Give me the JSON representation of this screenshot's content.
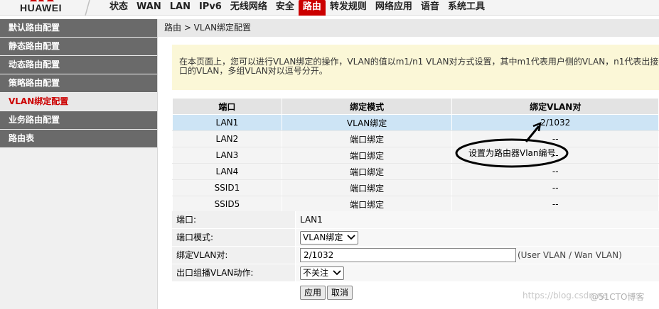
{
  "brand": {
    "logo_text": "HUAWEI",
    "accent": "#cc0000"
  },
  "nav": {
    "items": [
      "状态",
      "WAN",
      "LAN",
      "IPv6",
      "无线网络",
      "安全",
      "路由",
      "转发规则",
      "网络应用",
      "语音",
      "系统工具"
    ],
    "active": "路由"
  },
  "sidebar": {
    "items": [
      "默认路由配置",
      "静态路由配置",
      "动态路由配置",
      "策略路由配置",
      "VLAN绑定配置",
      "业务路由配置",
      "路由表"
    ],
    "active": "VLAN绑定配置"
  },
  "breadcrumb": "路由 > VLAN绑定配置",
  "info": "在本页面上，您可以进行VLAN绑定的操作，VLAN的值以m1/n1 VLAN对方式设置，其中m1代表用户侧的VLAN，n1代表出接口的VLAN，多组VLAN对以逗号分开。",
  "table": {
    "headers": [
      "端口",
      "绑定模式",
      "绑定VLAN对"
    ],
    "rows": [
      [
        "LAN1",
        "VLAN绑定",
        "2/1032"
      ],
      [
        "LAN2",
        "端口绑定",
        "--"
      ],
      [
        "LAN3",
        "端口绑定",
        "--"
      ],
      [
        "LAN4",
        "端口绑定",
        "--"
      ],
      [
        "SSID1",
        "端口绑定",
        "--"
      ],
      [
        "SSID5",
        "端口绑定",
        "--"
      ]
    ]
  },
  "form": {
    "port_label": "端口:",
    "port_value": "LAN1",
    "mode_label": "端口模式:",
    "mode_value": "VLAN绑定",
    "vlan_label": "绑定VLAN对:",
    "vlan_value": "2/1032",
    "vlan_hint": "(User VLAN / Wan VLAN)",
    "multicast_label": "出口组播VLAN动作:",
    "multicast_value": "不关注"
  },
  "buttons": {
    "apply": "应用",
    "cancel": "取消"
  },
  "annotation": "设置为路由器Vlan编号",
  "watermark": {
    "left": "https://blog.csdn.ne",
    "right": "@51CTO博客"
  }
}
